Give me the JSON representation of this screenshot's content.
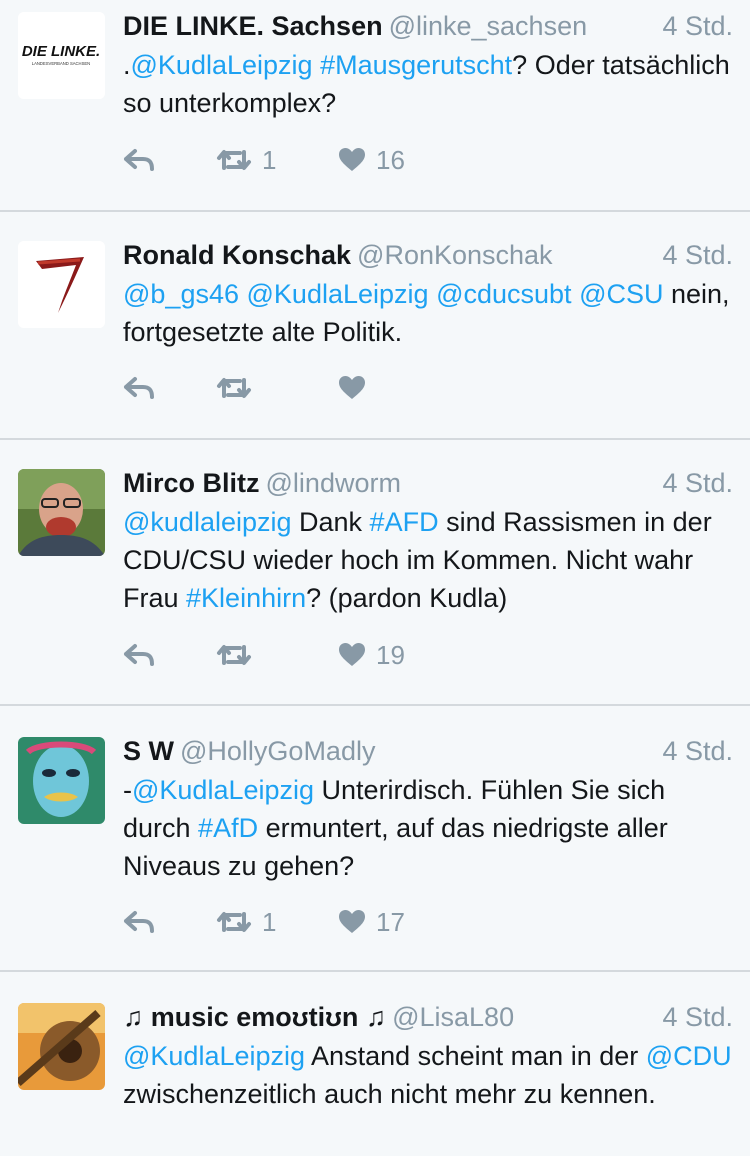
{
  "colors": {
    "background": "#f5f8fa",
    "link": "#1da1f2",
    "muted": "#8899a6",
    "divider": "#d4d9dd"
  },
  "tweets": [
    {
      "name": "DIE LINKE. Sachsen",
      "handle": "@linke_sachsen",
      "time": "4 Std.",
      "avatar": {
        "logo_text": "DIE LINKE.",
        "logo_sub": "LANDESVERBAND SACHSEN"
      },
      "text_parts": [
        {
          "t": ".",
          "link": false
        },
        {
          "t": "@KudlaLeipzig",
          "link": true
        },
        {
          "t": " ",
          "link": false
        },
        {
          "t": "#Mausgerutscht",
          "link": true
        },
        {
          "t": "? Oder tatsächlich so unterkomplex?",
          "link": false
        }
      ],
      "retweets": "1",
      "likes": "16"
    },
    {
      "name": "Ronald Konschak",
      "handle": "@RonKonschak",
      "time": "4 Std.",
      "avatar": {},
      "text_parts": [
        {
          "t": "@b_gs46",
          "link": true
        },
        {
          "t": " ",
          "link": false
        },
        {
          "t": "@KudlaLeipzig",
          "link": true
        },
        {
          "t": " ",
          "link": false
        },
        {
          "t": "@cducsubt",
          "link": true
        },
        {
          "t": " ",
          "link": false
        },
        {
          "t": "@CSU",
          "link": true
        },
        {
          "t": " nein, fortgesetzte alte Politik.",
          "link": false
        }
      ],
      "retweets": "",
      "likes": ""
    },
    {
      "name": "Mirco Blitz",
      "handle": "@lindworm",
      "time": "4 Std.",
      "avatar": {},
      "text_parts": [
        {
          "t": "@kudlaleipzig",
          "link": true
        },
        {
          "t": " Dank ",
          "link": false
        },
        {
          "t": "#AFD",
          "link": true
        },
        {
          "t": " sind Rassismen in der CDU/CSU wieder hoch im Kommen. Nicht wahr Frau ",
          "link": false
        },
        {
          "t": "#Kleinhirn",
          "link": true
        },
        {
          "t": "? (pardon Kudla)",
          "link": false
        }
      ],
      "retweets": "",
      "likes": "19"
    },
    {
      "name": "S W",
      "handle": "@HollyGoMadly",
      "time": "4 Std.",
      "avatar": {},
      "text_parts": [
        {
          "t": "-",
          "link": false
        },
        {
          "t": "@KudlaLeipzig",
          "link": true
        },
        {
          "t": " Unterirdisch. Fühlen Sie sich durch ",
          "link": false
        },
        {
          "t": "#AfD",
          "link": true
        },
        {
          "t": " ermuntert, auf das niedrigste aller Niveaus zu gehen?",
          "link": false
        }
      ],
      "retweets": "1",
      "likes": "17"
    },
    {
      "name": "♫ music emoʊtiʊn ♫",
      "handle": "@LisaL80",
      "time": "4 Std.",
      "avatar": {},
      "text_parts": [
        {
          "t": "@KudlaLeipzig",
          "link": true
        },
        {
          "t": " Anstand scheint man in der ",
          "link": false
        },
        {
          "t": "@CDU",
          "link": true
        },
        {
          "t": " zwischenzeitlich auch nicht mehr zu kennen.",
          "link": false
        }
      ],
      "retweets": "",
      "likes": ""
    }
  ],
  "icons": {
    "reply": "reply-icon",
    "retweet": "retweet-icon",
    "like": "heart-icon"
  }
}
